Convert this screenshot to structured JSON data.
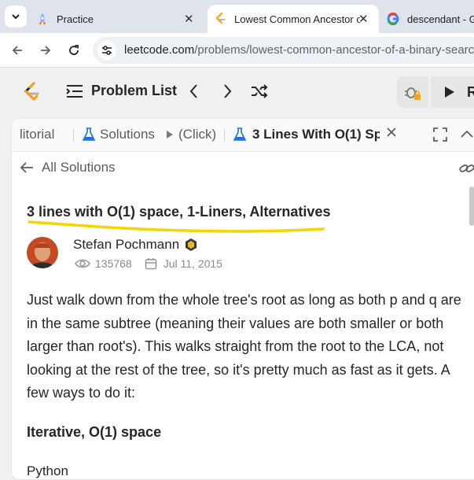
{
  "browser": {
    "tabs": [
      {
        "title": "Practice",
        "active": false
      },
      {
        "title": "Lowest Common Ancestor of",
        "active": true
      },
      {
        "title": "descendant - Go",
        "active": false
      }
    ],
    "close_glyph": "✕",
    "url_host": "leetcode.com",
    "url_path": "/problems/lowest-common-ancestor-of-a-binary-search-tr"
  },
  "leetcode": {
    "problem_list_label": "Problem List",
    "run_label": "R"
  },
  "panel": {
    "tabs": [
      {
        "label": "litorial"
      },
      {
        "label": "Solutions"
      },
      {
        "label": "(Click)"
      },
      {
        "label": "3 Lines With O(1) Sp"
      }
    ],
    "back_label": "All Solutions"
  },
  "article": {
    "title": "3 lines with O(1) space, 1-Liners, Alternatives",
    "author": "Stefan Pochmann",
    "views": "135768",
    "date": "Jul 11, 2015",
    "body": "Just walk down from the whole tree's root as long as both p and q are in the same subtree (meaning their values are both smaller or both larger than root's). This walks straight from the root to the LCA, not looking at the rest of the tree, so it's pretty much as fast as it gets. A few ways to do it:",
    "section_heading": "Iterative, O(1) space",
    "code_language": "Python"
  },
  "colors": {
    "highlight_underline": "#f5d400",
    "accent_blue": "#1a73e8",
    "leetcode_orange": "#ffa116"
  }
}
